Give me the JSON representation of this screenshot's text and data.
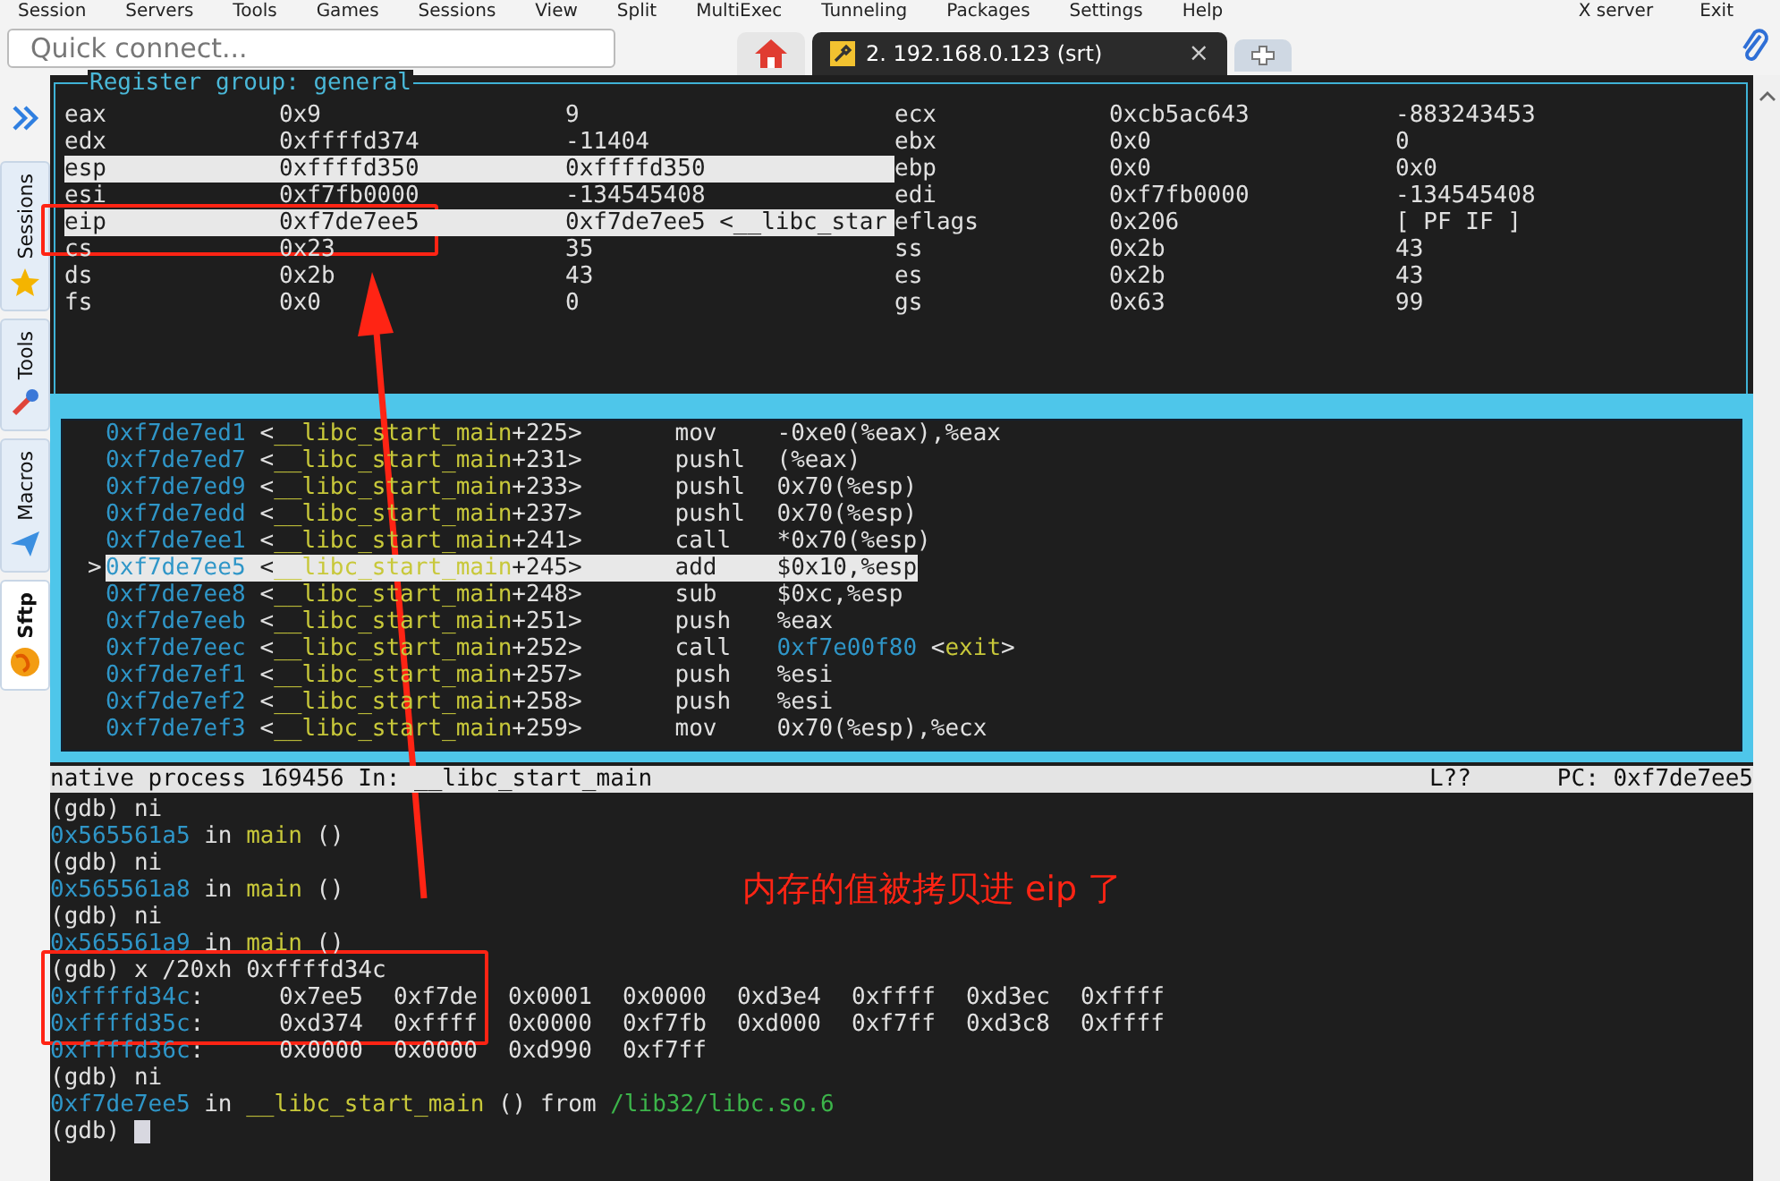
{
  "menu_bar": {
    "items": [
      "Session",
      "Servers",
      "Tools",
      "Games",
      "Sessions",
      "View",
      "Split",
      "MultiExec",
      "Tunneling",
      "Packages",
      "Settings",
      "Help"
    ],
    "right_items": [
      "X server",
      "Exit"
    ]
  },
  "toolbar": {
    "quick_connect": {
      "placeholder": "Quick connect..."
    },
    "tabs": [
      {
        "kind": "home",
        "selected": false
      },
      {
        "kind": "session",
        "label": "2. 192.168.0.123 (srt)",
        "close": "×",
        "selected": true
      },
      {
        "kind": "new",
        "selected": false
      }
    ]
  },
  "sidebar": {
    "tabs": [
      {
        "label": "Sessions",
        "kind": "star",
        "selected": false
      },
      {
        "label": "Tools",
        "kind": "tools",
        "selected": false
      },
      {
        "label": "Macros",
        "kind": "plane",
        "selected": false
      },
      {
        "label": "Sftp",
        "kind": "globe",
        "selected": true
      }
    ]
  },
  "register_pane": {
    "title": "Register group: general",
    "rows": [
      {
        "left": {
          "name": "eax",
          "hex": "0x9",
          "natural": "9",
          "changed": false
        },
        "right": {
          "name": "ecx",
          "hex": "0xcb5ac643",
          "natural": "-883243453",
          "changed": false
        }
      },
      {
        "left": {
          "name": "edx",
          "hex": "0xffffd374",
          "natural": "-11404",
          "changed": false
        },
        "right": {
          "name": "ebx",
          "hex": "0x0",
          "natural": "0",
          "changed": false
        }
      },
      {
        "left": {
          "name": "esp",
          "hex": "0xffffd350",
          "natural": "0xffffd350",
          "changed": true
        },
        "right": {
          "name": "ebp",
          "hex": "0x0",
          "natural": "0x0",
          "changed": false
        }
      },
      {
        "left": {
          "name": "esi",
          "hex": "0xf7fb0000",
          "natural": "-134545408",
          "changed": false
        },
        "right": {
          "name": "edi",
          "hex": "0xf7fb0000",
          "natural": "-134545408",
          "changed": false
        }
      },
      {
        "left": {
          "name": "eip",
          "hex": "0xf7de7ee5",
          "natural": "0xf7de7ee5 <__libc_star",
          "changed": true
        },
        "right": {
          "name": "eflags",
          "hex": "0x206",
          "natural": "[ PF IF ]",
          "changed": false
        }
      },
      {
        "left": {
          "name": "cs",
          "hex": "0x23",
          "natural": "35",
          "changed": false
        },
        "right": {
          "name": "ss",
          "hex": "0x2b",
          "natural": "43",
          "changed": false
        }
      },
      {
        "left": {
          "name": "ds",
          "hex": "0x2b",
          "natural": "43",
          "changed": false
        },
        "right": {
          "name": "es",
          "hex": "0x2b",
          "natural": "43",
          "changed": false
        }
      },
      {
        "left": {
          "name": "fs",
          "hex": "0x0",
          "natural": "0",
          "changed": false
        },
        "right": {
          "name": "gs",
          "hex": "0x63",
          "natural": "99",
          "changed": false
        }
      }
    ]
  },
  "disassembly": {
    "marker": ">",
    "lines": [
      {
        "address": "0xf7de7ed1",
        "symbol": [
          {
            "kind": "plain",
            "text": "<"
          },
          {
            "kind": "func",
            "text": "__libc_start_main"
          },
          {
            "kind": "plain",
            "text": "+225>"
          }
        ],
        "mnemonic": "mov",
        "operands": [
          {
            "kind": "plain",
            "text": "-0xe0(%eax),%eax"
          }
        ],
        "selected": false
      },
      {
        "address": "0xf7de7ed7",
        "symbol": [
          {
            "kind": "plain",
            "text": "<"
          },
          {
            "kind": "func",
            "text": "__libc_start_main"
          },
          {
            "kind": "plain",
            "text": "+231>"
          }
        ],
        "mnemonic": "pushl",
        "operands": [
          {
            "kind": "plain",
            "text": "(%eax)"
          }
        ],
        "selected": false
      },
      {
        "address": "0xf7de7ed9",
        "symbol": [
          {
            "kind": "plain",
            "text": "<"
          },
          {
            "kind": "func",
            "text": "__libc_start_main"
          },
          {
            "kind": "plain",
            "text": "+233>"
          }
        ],
        "mnemonic": "pushl",
        "operands": [
          {
            "kind": "plain",
            "text": "0x70(%esp)"
          }
        ],
        "selected": false
      },
      {
        "address": "0xf7de7edd",
        "symbol": [
          {
            "kind": "plain",
            "text": "<"
          },
          {
            "kind": "func",
            "text": "__libc_start_main"
          },
          {
            "kind": "plain",
            "text": "+237>"
          }
        ],
        "mnemonic": "pushl",
        "operands": [
          {
            "kind": "plain",
            "text": "0x70(%esp)"
          }
        ],
        "selected": false
      },
      {
        "address": "0xf7de7ee1",
        "symbol": [
          {
            "kind": "plain",
            "text": "<"
          },
          {
            "kind": "func",
            "text": "__libc_start_main"
          },
          {
            "kind": "plain",
            "text": "+241>"
          }
        ],
        "mnemonic": "call",
        "operands": [
          {
            "kind": "plain",
            "text": "*0x70(%esp)"
          }
        ],
        "selected": false
      },
      {
        "address": "0xf7de7ee5",
        "symbol": [
          {
            "kind": "plain",
            "text": "<"
          },
          {
            "kind": "func",
            "text": "__libc_start_main"
          },
          {
            "kind": "plain",
            "text": "+245>"
          }
        ],
        "mnemonic": "add",
        "operands": [
          {
            "kind": "plain",
            "text": "$0x10,%esp"
          }
        ],
        "selected": true
      },
      {
        "address": "0xf7de7ee8",
        "symbol": [
          {
            "kind": "plain",
            "text": "<"
          },
          {
            "kind": "func",
            "text": "__libc_start_main"
          },
          {
            "kind": "plain",
            "text": "+248>"
          }
        ],
        "mnemonic": "sub",
        "operands": [
          {
            "kind": "plain",
            "text": "$0xc,%esp"
          }
        ],
        "selected": false
      },
      {
        "address": "0xf7de7eeb",
        "symbol": [
          {
            "kind": "plain",
            "text": "<"
          },
          {
            "kind": "func",
            "text": "__libc_start_main"
          },
          {
            "kind": "plain",
            "text": "+251>"
          }
        ],
        "mnemonic": "push",
        "operands": [
          {
            "kind": "plain",
            "text": "%eax"
          }
        ],
        "selected": false
      },
      {
        "address": "0xf7de7eec",
        "symbol": [
          {
            "kind": "plain",
            "text": "<"
          },
          {
            "kind": "func",
            "text": "__libc_start_main"
          },
          {
            "kind": "plain",
            "text": "+252>"
          }
        ],
        "mnemonic": "call",
        "operands": [
          {
            "kind": "addr",
            "text": "0xf7e00f80"
          },
          {
            "kind": "plain",
            "text": " <"
          },
          {
            "kind": "func",
            "text": "exit"
          },
          {
            "kind": "plain",
            "text": ">"
          }
        ],
        "selected": false
      },
      {
        "address": "0xf7de7ef1",
        "symbol": [
          {
            "kind": "plain",
            "text": "<"
          },
          {
            "kind": "func",
            "text": "__libc_start_main"
          },
          {
            "kind": "plain",
            "text": "+257>"
          }
        ],
        "mnemonic": "push",
        "operands": [
          {
            "kind": "plain",
            "text": "%esi"
          }
        ],
        "selected": false
      },
      {
        "address": "0xf7de7ef2",
        "symbol": [
          {
            "kind": "plain",
            "text": "<"
          },
          {
            "kind": "func",
            "text": "__libc_start_main"
          },
          {
            "kind": "plain",
            "text": "+258>"
          }
        ],
        "mnemonic": "push",
        "operands": [
          {
            "kind": "plain",
            "text": "%esi"
          }
        ],
        "selected": false
      },
      {
        "address": "0xf7de7ef3",
        "symbol": [
          {
            "kind": "plain",
            "text": "<"
          },
          {
            "kind": "func",
            "text": "__libc_start_main"
          },
          {
            "kind": "plain",
            "text": "+259>"
          }
        ],
        "mnemonic": "mov",
        "operands": [
          {
            "kind": "plain",
            "text": "0x70(%esp),%ecx"
          }
        ],
        "selected": false
      }
    ]
  },
  "status_bar": {
    "process": "native process 169456 In: __libc_start_main",
    "line": "L??",
    "pc": "PC: 0xf7de7ee5"
  },
  "console": {
    "cursor": true,
    "lines": [
      {
        "kind": "text",
        "segments": [
          {
            "kind": "plain",
            "text": "(gdb) ni"
          }
        ]
      },
      {
        "kind": "text",
        "segments": [
          {
            "kind": "addr",
            "text": "0x565561a5"
          },
          {
            "kind": "plain",
            "text": " in "
          },
          {
            "kind": "func",
            "text": "main"
          },
          {
            "kind": "plain",
            "text": " ()"
          }
        ]
      },
      {
        "kind": "text",
        "segments": [
          {
            "kind": "plain",
            "text": "(gdb) ni"
          }
        ]
      },
      {
        "kind": "text",
        "segments": [
          {
            "kind": "addr",
            "text": "0x565561a8"
          },
          {
            "kind": "plain",
            "text": " in "
          },
          {
            "kind": "func",
            "text": "main"
          },
          {
            "kind": "plain",
            "text": " ()"
          }
        ]
      },
      {
        "kind": "text",
        "segments": [
          {
            "kind": "plain",
            "text": "(gdb) ni"
          }
        ]
      },
      {
        "kind": "text",
        "segments": [
          {
            "kind": "addr",
            "text": "0x565561a9"
          },
          {
            "kind": "plain",
            "text": " in "
          },
          {
            "kind": "func",
            "text": "main"
          },
          {
            "kind": "plain",
            "text": " ()"
          }
        ]
      },
      {
        "kind": "text",
        "segments": [
          {
            "kind": "plain",
            "text": "(gdb) x /20xh 0xffffd34c"
          }
        ]
      },
      {
        "kind": "memory",
        "address": "0xffffd34c",
        "separator": ":",
        "words": [
          "0x7ee5",
          "0xf7de",
          "0x0001",
          "0x0000",
          "0xd3e4",
          "0xffff",
          "0xd3ec",
          "0xffff"
        ]
      },
      {
        "kind": "memory",
        "address": "0xffffd35c",
        "separator": ":",
        "words": [
          "0xd374",
          "0xffff",
          "0x0000",
          "0xf7fb",
          "0xd000",
          "0xf7ff",
          "0xd3c8",
          "0xffff"
        ]
      },
      {
        "kind": "memory",
        "address": "0xffffd36c",
        "separator": ":",
        "words": [
          "0x0000",
          "0x0000",
          "0xd990",
          "0xf7ff"
        ]
      },
      {
        "kind": "text",
        "segments": [
          {
            "kind": "plain",
            "text": "(gdb) ni"
          }
        ]
      },
      {
        "kind": "text",
        "segments": [
          {
            "kind": "addr",
            "text": "0xf7de7ee5"
          },
          {
            "kind": "plain",
            "text": " in "
          },
          {
            "kind": "func",
            "text": "__libc_start_main"
          },
          {
            "kind": "plain",
            "text": " () from "
          },
          {
            "kind": "path",
            "text": "/lib32/libc.so.6"
          }
        ]
      },
      {
        "kind": "text",
        "segments": [
          {
            "kind": "plain",
            "text": "(gdb) "
          }
        ]
      }
    ]
  },
  "annotation": {
    "text": "内存的值被拷贝进 eip 了"
  }
}
